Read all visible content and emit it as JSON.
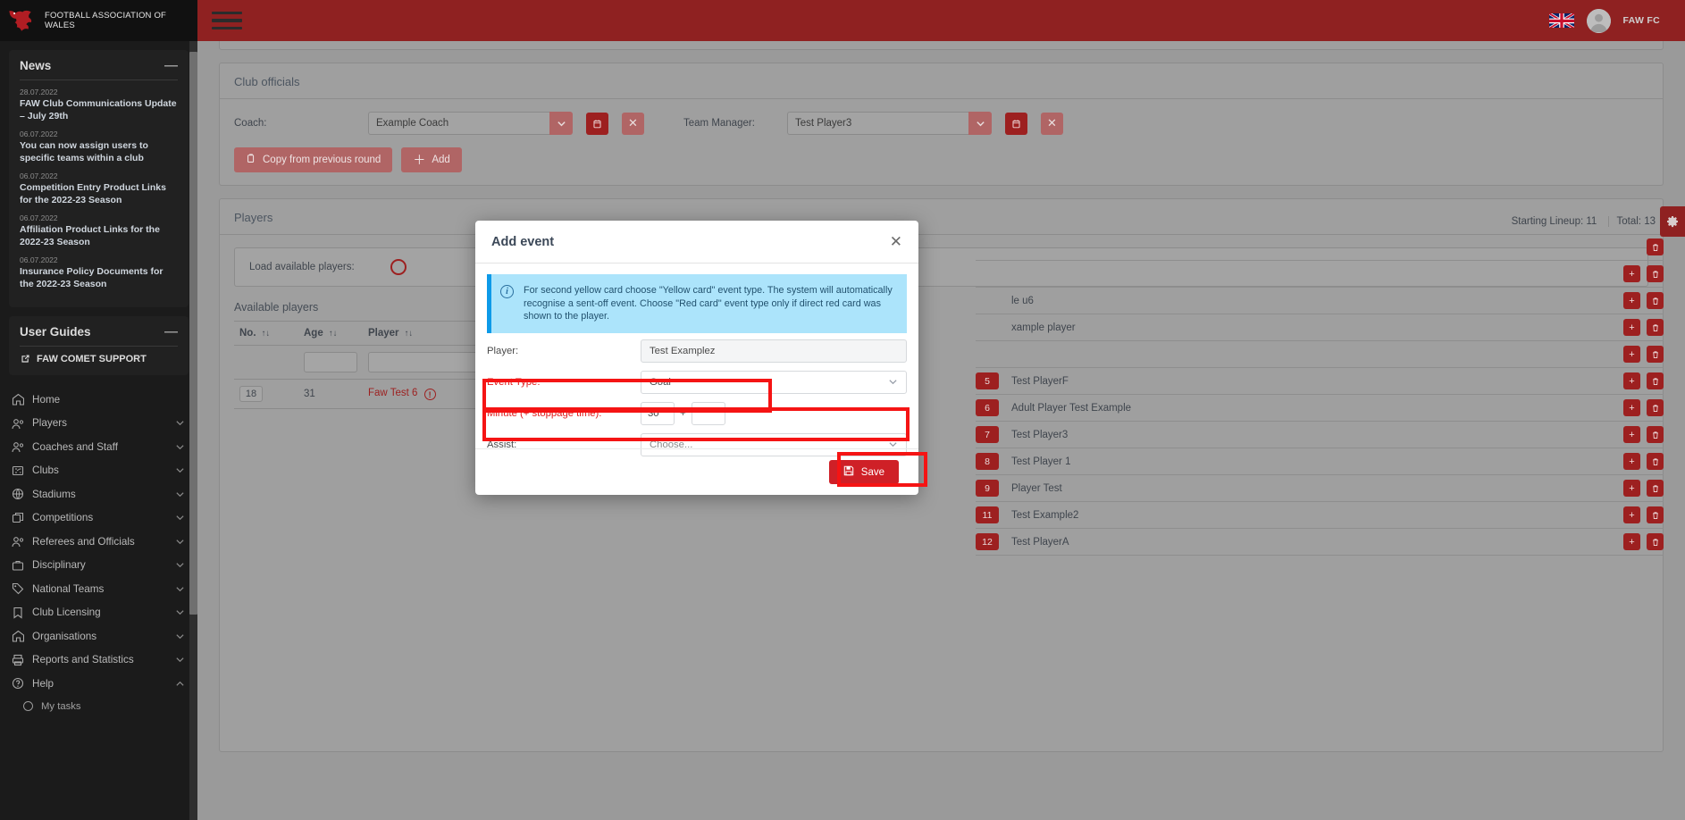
{
  "brand": {
    "name": "FOOTBALL ASSOCIATION OF WALES",
    "logo_icon": "welsh-dragon-icon"
  },
  "topbar": {
    "menu_icon": "hamburger-icon",
    "flag_icon": "union-jack-flag-icon",
    "avatar_icon": "user-avatar-icon",
    "user_name": "FAW FC"
  },
  "sidebar": {
    "news_panel": {
      "title": "News",
      "collapse_icon": "minus-icon",
      "items": [
        {
          "date": "28.07.2022",
          "title": "FAW Club Communications Update – July 29th"
        },
        {
          "date": "06.07.2022",
          "title": "You can now assign users to specific teams within a club"
        },
        {
          "date": "06.07.2022",
          "title": "Competition Entry Product Links for the 2022-23 Season"
        },
        {
          "date": "06.07.2022",
          "title": "Affiliation Product Links for the 2022-23 Season"
        },
        {
          "date": "06.07.2022",
          "title": "Insurance Policy Documents for the 2022-23 Season"
        }
      ]
    },
    "guides_panel": {
      "title": "User Guides",
      "collapse_icon": "minus-icon",
      "link_label": "FAW COMET SUPPORT",
      "link_icon": "external-link-icon"
    },
    "nav": [
      {
        "label": "Home",
        "icon": "home-icon",
        "chevron": false
      },
      {
        "label": "Players",
        "icon": "people-icon",
        "chevron": true
      },
      {
        "label": "Coaches and Staff",
        "icon": "people-icon",
        "chevron": true
      },
      {
        "label": "Clubs",
        "icon": "club-badge-icon",
        "chevron": true
      },
      {
        "label": "Stadiums",
        "icon": "globe-icon",
        "chevron": true
      },
      {
        "label": "Competitions",
        "icon": "copy-icon",
        "chevron": true
      },
      {
        "label": "Referees and Officials",
        "icon": "people-icon",
        "chevron": true
      },
      {
        "label": "Disciplinary",
        "icon": "briefcase-icon",
        "chevron": true
      },
      {
        "label": "National Teams",
        "icon": "tag-icon",
        "chevron": true
      },
      {
        "label": "Club Licensing",
        "icon": "bookmark-icon",
        "chevron": true
      },
      {
        "label": "Organisations",
        "icon": "home-icon",
        "chevron": true
      },
      {
        "label": "Reports and Statistics",
        "icon": "printer-icon",
        "chevron": true
      },
      {
        "label": "Help",
        "icon": "question-circle-icon",
        "chevron": true,
        "expanded": true
      }
    ],
    "nav_sub": [
      {
        "label": "My tasks",
        "icon": "circle-icon"
      }
    ]
  },
  "officials_card": {
    "title": "Club officials",
    "coach_label": "Coach:",
    "coach_value": "Example Coach",
    "manager_label": "Team Manager:",
    "manager_value": "Test Player3",
    "dropdown_icon": "chevron-down-icon",
    "calendar_icon": "calendar-icon",
    "clear_icon": "close-x-icon",
    "copy_button": "Copy from previous round",
    "copy_icon": "copy-icon",
    "add_button": "Add",
    "add_icon": "plus-icon"
  },
  "players_card": {
    "title": "Players",
    "load_label": "Load available players:",
    "load_icon": "loading-spinner-icon",
    "available_title": "Available players",
    "columns": [
      {
        "label": "No.",
        "sort_icon": "sort-updown-icon"
      },
      {
        "label": "Age",
        "sort_icon": "sort-updown-icon"
      },
      {
        "label": "Player",
        "sort_icon": "sort-updown-icon"
      }
    ],
    "rows": [
      {
        "no": "18",
        "age": "31",
        "player": "Faw Test 6",
        "warn_icon": "warning-circle-icon"
      }
    ]
  },
  "lineup": {
    "starting_label": "Starting Lineup: 11",
    "total_label": "Total: 13",
    "add_icon": "plus-icon",
    "delete_icon": "trash-icon",
    "rows": [
      {
        "no": "",
        "name": "",
        "has_add": false,
        "has_delete": true
      },
      {
        "no": "",
        "name": "",
        "has_add": true,
        "has_delete": true
      },
      {
        "no": "",
        "name": "le u6",
        "has_add": true,
        "has_delete": true
      },
      {
        "no": "",
        "name": "xample player",
        "has_add": true,
        "has_delete": true
      },
      {
        "no": "",
        "name": "",
        "has_add": true,
        "has_delete": true
      },
      {
        "no": "5",
        "name": "Test PlayerF",
        "has_add": true,
        "has_delete": true
      },
      {
        "no": "6",
        "name": "Adult Player Test Example",
        "has_add": true,
        "has_delete": true
      },
      {
        "no": "7",
        "name": "Test Player3",
        "has_add": true,
        "has_delete": true
      },
      {
        "no": "8",
        "name": "Test Player 1",
        "has_add": true,
        "has_delete": true
      },
      {
        "no": "9",
        "name": "Player Test",
        "has_add": true,
        "has_delete": true
      },
      {
        "no": "11",
        "name": "Test Example2",
        "has_add": true,
        "has_delete": true
      },
      {
        "no": "12",
        "name": "Test PlayerA",
        "has_add": true,
        "has_delete": true
      }
    ]
  },
  "gear_tab": {
    "icon": "gear-icon"
  },
  "modal": {
    "title": "Add event",
    "close_icon": "close-x-icon",
    "info_icon": "info-circle-icon",
    "info_text": "For second yellow card choose \"Yellow card\" event type. The system will automatically recognise a sent-off event. Choose \"Red card\" event type only if direct red card was shown to the player.",
    "fields": {
      "player_label": "Player:",
      "player_value": "Test Examplez",
      "event_type_label": "Event Type:",
      "event_type_value": "Goal",
      "minute_label": "Minute (+ stoppage time):",
      "minute_value": "30",
      "stoppage_value": "",
      "plus_sign": "+",
      "assist_label": "Assist:",
      "assist_value": "Choose...",
      "dropdown_icon": "chevron-down-icon"
    },
    "save_label": "Save",
    "save_icon": "save-disk-icon"
  },
  "colors": {
    "brand_red": "#8f2121",
    "accent_red": "#9d2020",
    "highlight_red": "#f51414",
    "info_blue": "#0d9ae8",
    "info_bg": "#ace4fb",
    "save_red": "#cf2027"
  }
}
